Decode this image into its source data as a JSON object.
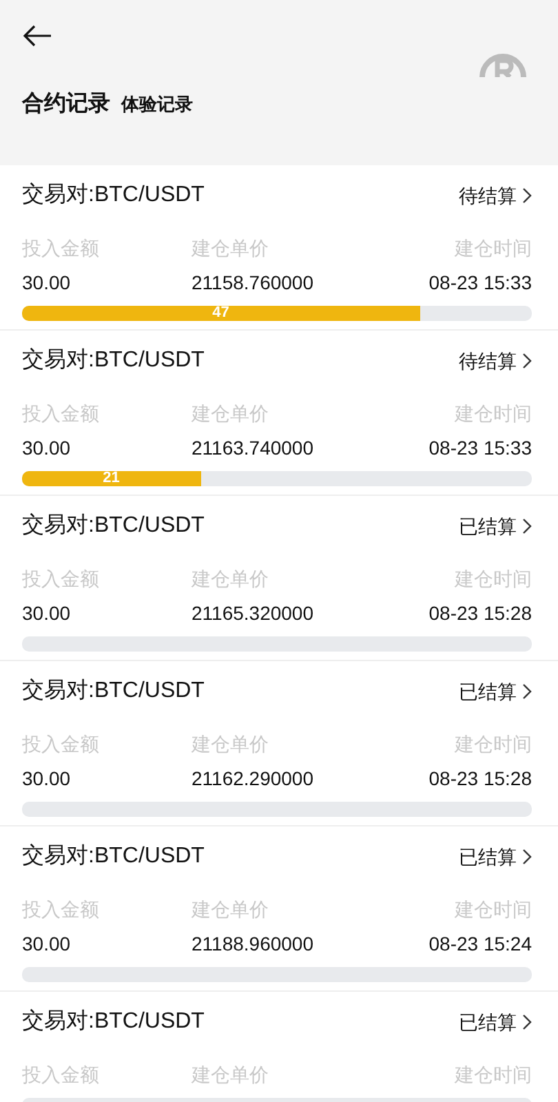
{
  "header": {
    "tabs": [
      {
        "label": "合约记录",
        "selected": true
      },
      {
        "label": "体验记录",
        "selected": false
      }
    ]
  },
  "records": [
    {
      "pair": "交易对:BTC/USDT",
      "status": "待结算",
      "labels": [
        "投入金额",
        "建仓单价",
        "建仓时间"
      ],
      "amount": "30.00",
      "price": "21158.760000",
      "time": "08-23 15:33",
      "level": 0.78,
      "countdown": "47"
    },
    {
      "pair": "交易对:BTC/USDT",
      "status": "待结算",
      "labels": [
        "投入金额",
        "建仓单价",
        "建仓时间"
      ],
      "amount": "30.00",
      "price": "21163.740000",
      "time": "08-23 15:33",
      "level": 0.35,
      "countdown": "21"
    },
    {
      "pair": "交易对:BTC/USDT",
      "status": "已结算",
      "labels": [
        "投入金额",
        "建仓单价",
        "建仓时间"
      ],
      "amount": "30.00",
      "price": "21165.320000",
      "time": "08-23 15:28",
      "level": 0
    },
    {
      "pair": "交易对:BTC/USDT",
      "status": "已结算",
      "labels": [
        "投入金额",
        "建仓单价",
        "建仓时间"
      ],
      "amount": "30.00",
      "price": "21162.290000",
      "time": "08-23 15:28",
      "level": 0
    },
    {
      "pair": "交易对:BTC/USDT",
      "status": "已结算",
      "labels": [
        "投入金额",
        "建仓单价",
        "建仓时间"
      ],
      "amount": "30.00",
      "price": "21188.960000",
      "time": "08-23 15:24",
      "level": 0
    },
    {
      "pair": "交易对:BTC/USDT",
      "status": "已结算",
      "labels": [
        "投入金额",
        "建仓单价",
        "建仓时间"
      ],
      "level": 0
    }
  ]
}
